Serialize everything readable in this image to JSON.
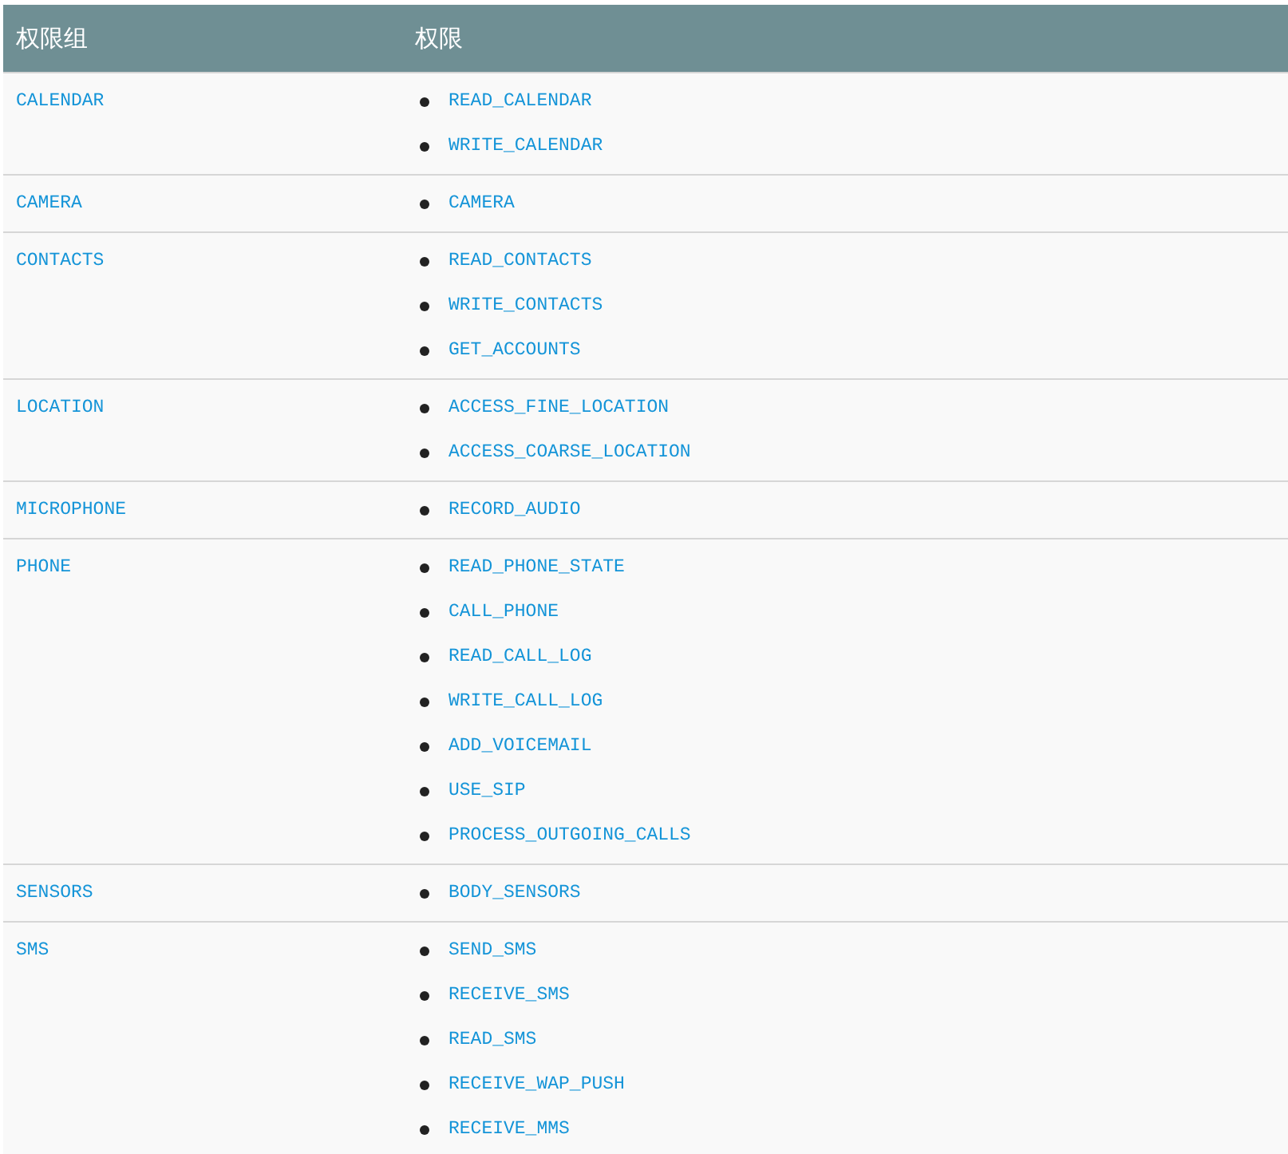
{
  "table": {
    "columns": [
      "权限组",
      "权限"
    ],
    "rows": [
      {
        "group": "CALENDAR",
        "permissions": [
          "READ_CALENDAR",
          "WRITE_CALENDAR"
        ]
      },
      {
        "group": "CAMERA",
        "permissions": [
          "CAMERA"
        ]
      },
      {
        "group": "CONTACTS",
        "permissions": [
          "READ_CONTACTS",
          "WRITE_CONTACTS",
          "GET_ACCOUNTS"
        ]
      },
      {
        "group": "LOCATION",
        "permissions": [
          "ACCESS_FINE_LOCATION",
          "ACCESS_COARSE_LOCATION"
        ]
      },
      {
        "group": "MICROPHONE",
        "permissions": [
          "RECORD_AUDIO"
        ]
      },
      {
        "group": "PHONE",
        "permissions": [
          "READ_PHONE_STATE",
          "CALL_PHONE",
          "READ_CALL_LOG",
          "WRITE_CALL_LOG",
          "ADD_VOICEMAIL",
          "USE_SIP",
          "PROCESS_OUTGOING_CALLS"
        ]
      },
      {
        "group": "SENSORS",
        "permissions": [
          "BODY_SENSORS"
        ]
      },
      {
        "group": "SMS",
        "permissions": [
          "SEND_SMS",
          "RECEIVE_SMS",
          "READ_SMS",
          "RECEIVE_WAP_PUSH",
          "RECEIVE_MMS"
        ]
      }
    ]
  }
}
